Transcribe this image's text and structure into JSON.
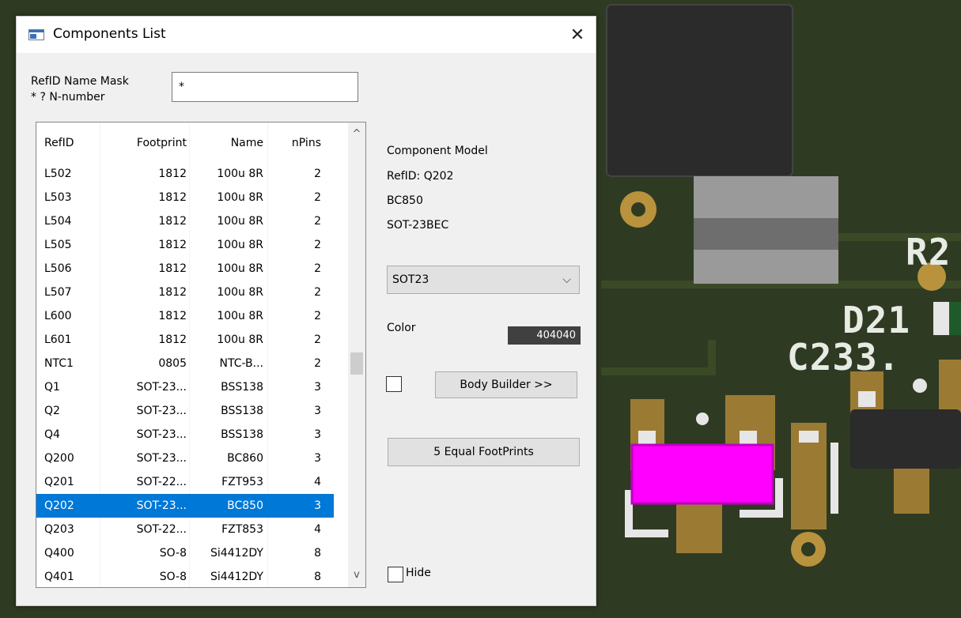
{
  "window": {
    "title": "Components List",
    "close_glyph": "✕"
  },
  "mask": {
    "label_line1": "RefID Name Mask",
    "label_line2": "* ? N-number",
    "value": "*"
  },
  "table": {
    "columns": [
      "RefID",
      "Footprint",
      "Name",
      "nPins"
    ],
    "rows": [
      [
        "L502",
        "1812",
        "100u 8R",
        "2"
      ],
      [
        "L503",
        "1812",
        "100u 8R",
        "2"
      ],
      [
        "L504",
        "1812",
        "100u 8R",
        "2"
      ],
      [
        "L505",
        "1812",
        "100u 8R",
        "2"
      ],
      [
        "L506",
        "1812",
        "100u 8R",
        "2"
      ],
      [
        "L507",
        "1812",
        "100u 8R",
        "2"
      ],
      [
        "L600",
        "1812",
        "100u 8R",
        "2"
      ],
      [
        "L601",
        "1812",
        "100u 8R",
        "2"
      ],
      [
        "NTC1",
        "0805",
        "NTC-B...",
        "2"
      ],
      [
        "Q1",
        "SOT-23...",
        "BSS138",
        "3"
      ],
      [
        "Q2",
        "SOT-23...",
        "BSS138",
        "3"
      ],
      [
        "Q4",
        "SOT-23...",
        "BSS138",
        "3"
      ],
      [
        "Q200",
        "SOT-23...",
        "BC860",
        "3"
      ],
      [
        "Q201",
        "SOT-22...",
        "FZT953",
        "4"
      ],
      [
        "Q202",
        "SOT-23...",
        "BC850",
        "3"
      ],
      [
        "Q203",
        "SOT-22...",
        "FZT853",
        "4"
      ],
      [
        "Q400",
        "SO-8",
        "Si4412DY",
        "8"
      ],
      [
        "Q401",
        "SO-8",
        "Si4412DY",
        "8"
      ]
    ],
    "selected_index": 14,
    "scroll_up_glyph": "^",
    "scroll_down_glyph": "v"
  },
  "component_model": {
    "heading": "Component Model",
    "refid_line": "RefID: Q202",
    "name_line": "BC850",
    "footprint_line": "SOT-23BEC"
  },
  "model_select": {
    "value": "SOT23",
    "chevron": "⌵"
  },
  "color": {
    "label": "Color",
    "value": "404040",
    "hex": "#404040"
  },
  "body_builder": {
    "checked": false,
    "label": "Body Builder >>"
  },
  "equal_footprints": {
    "label": "5 Equal FootPrints"
  },
  "hide": {
    "checked": false,
    "label": "Hide"
  },
  "pcb_labels": {
    "r": "R2",
    "d": "D21",
    "c": "C233."
  },
  "colors": {
    "selection": "#0078d7",
    "board": "#2f3a22",
    "pad": "#9b7b34",
    "magenta": "#ff00ff"
  }
}
